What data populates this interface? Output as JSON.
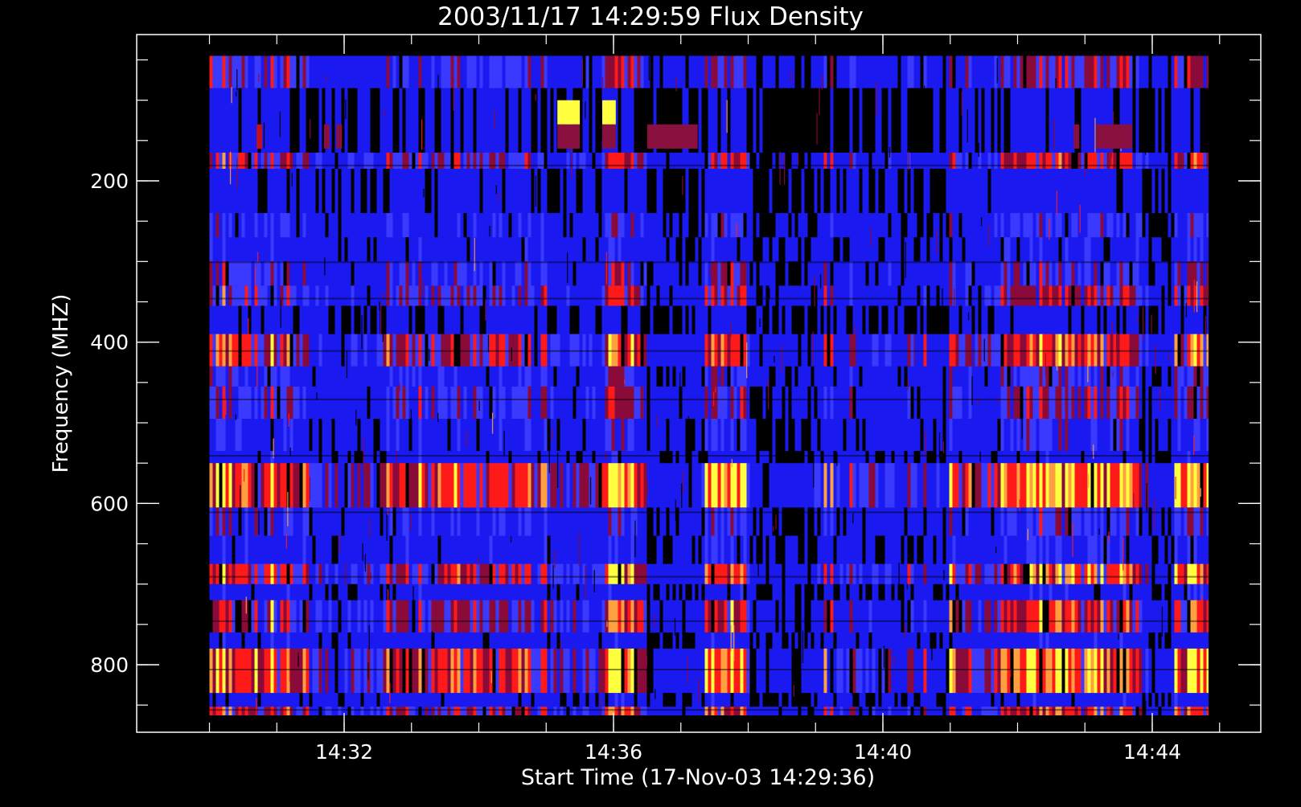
{
  "chart_data": {
    "type": "heatmap",
    "title": "2003/11/17 14:29:59 Flux Density",
    "xlabel": "Start Time (17-Nov-03 14:29:36)",
    "ylabel": "Frequency (MHZ)",
    "x_unit": "time (HH:MM)",
    "xlim": [
      "14:29:36",
      "14:45:00"
    ],
    "ylim": [
      850,
      45
    ],
    "y_inverted": true,
    "x_ticks": [
      {
        "value": "14:32",
        "label": "14:32"
      },
      {
        "value": "14:36",
        "label": "14:36"
      },
      {
        "value": "14:40",
        "label": "14:40"
      },
      {
        "value": "14:44",
        "label": "14:44"
      }
    ],
    "y_ticks": [
      {
        "value": 200,
        "label": "200"
      },
      {
        "value": 400,
        "label": "400"
      },
      {
        "value": 600,
        "label": "600"
      },
      {
        "value": 800,
        "label": "800"
      }
    ],
    "x_minor_ticks_minutes": [
      "14:30",
      "14:31",
      "14:32",
      "14:33",
      "14:34",
      "14:35",
      "14:36",
      "14:37",
      "14:38",
      "14:39",
      "14:40",
      "14:41",
      "14:42",
      "14:43",
      "14:44",
      "14:45"
    ],
    "y_minor_ticks": [
      50,
      100,
      150,
      200,
      250,
      300,
      350,
      400,
      450,
      500,
      550,
      600,
      650,
      700,
      750,
      800,
      850
    ],
    "data_extent": {
      "time_start": "14:30:00",
      "time_end": "14:45:00",
      "freq_top": 45,
      "freq_bottom": 867
    },
    "colormap": [
      "#000000",
      "#1010ff",
      "#3a3aff",
      "#8a0a3a",
      "#ff1a1a",
      "#ffa040",
      "#ffff40"
    ],
    "background_color": "#1a1af0",
    "frequency_bands": [
      {
        "f1": 45,
        "f2": 85,
        "intensity": 0.55
      },
      {
        "f1": 85,
        "f2": 165,
        "intensity": 0.15
      },
      {
        "f1": 165,
        "f2": 185,
        "intensity": 0.65
      },
      {
        "f1": 185,
        "f2": 240,
        "intensity": 0.25
      },
      {
        "f1": 240,
        "f2": 270,
        "intensity": 0.45
      },
      {
        "f1": 270,
        "f2": 300,
        "intensity": 0.35
      },
      {
        "f1": 300,
        "f2": 330,
        "intensity": 0.5
      },
      {
        "f1": 330,
        "f2": 355,
        "intensity": 0.6
      },
      {
        "f1": 355,
        "f2": 390,
        "intensity": 0.2
      },
      {
        "f1": 390,
        "f2": 430,
        "intensity": 0.75
      },
      {
        "f1": 430,
        "f2": 455,
        "intensity": 0.45
      },
      {
        "f1": 455,
        "f2": 495,
        "intensity": 0.55
      },
      {
        "f1": 495,
        "f2": 535,
        "intensity": 0.4
      },
      {
        "f1": 535,
        "f2": 550,
        "intensity": 0.3
      },
      {
        "f1": 550,
        "f2": 605,
        "intensity": 0.9
      },
      {
        "f1": 605,
        "f2": 640,
        "intensity": 0.45
      },
      {
        "f1": 640,
        "f2": 675,
        "intensity": 0.35
      },
      {
        "f1": 675,
        "f2": 700,
        "intensity": 0.8
      },
      {
        "f1": 700,
        "f2": 720,
        "intensity": 0.3
      },
      {
        "f1": 720,
        "f2": 760,
        "intensity": 0.7
      },
      {
        "f1": 760,
        "f2": 780,
        "intensity": 0.3
      },
      {
        "f1": 780,
        "f2": 835,
        "intensity": 0.85
      },
      {
        "f1": 835,
        "f2": 852,
        "intensity": 0.3
      },
      {
        "f1": 852,
        "f2": 867,
        "intensity": 0.7
      }
    ],
    "burst_periods": [
      {
        "t1": "14:30:00",
        "t2": "14:31:30",
        "intensity": 0.8
      },
      {
        "t1": "14:31:30",
        "t2": "14:32:30",
        "intensity": 0.5
      },
      {
        "t1": "14:32:30",
        "t2": "14:33:30",
        "intensity": 0.65
      },
      {
        "t1": "14:33:30",
        "t2": "14:35:00",
        "intensity": 0.75
      },
      {
        "t1": "14:35:00",
        "t2": "14:35:50",
        "intensity": 0.55
      },
      {
        "t1": "14:35:50",
        "t2": "14:36:30",
        "intensity": 0.95
      },
      {
        "t1": "14:36:30",
        "t2": "14:37:20",
        "intensity": 0.3
      },
      {
        "t1": "14:37:20",
        "t2": "14:38:00",
        "intensity": 0.95
      },
      {
        "t1": "14:38:00",
        "t2": "14:39:00",
        "intensity": 0.2
      },
      {
        "t1": "14:39:00",
        "t2": "14:40:10",
        "intensity": 0.5
      },
      {
        "t1": "14:40:10",
        "t2": "14:41:00",
        "intensity": 0.35
      },
      {
        "t1": "14:41:00",
        "t2": "14:41:40",
        "intensity": 0.7
      },
      {
        "t1": "14:41:40",
        "t2": "14:43:50",
        "intensity": 0.9
      },
      {
        "t1": "14:43:50",
        "t2": "14:44:20",
        "intensity": 0.25
      },
      {
        "t1": "14:44:20",
        "t2": "14:45:00",
        "intensity": 0.95
      }
    ],
    "highlight_patches": [
      {
        "t1": "14:35:10",
        "t2": "14:35:30",
        "f1": 100,
        "f2": 130,
        "color": "#ffff40"
      },
      {
        "t1": "14:35:50",
        "t2": "14:36:02",
        "f1": 100,
        "f2": 130,
        "color": "#ffff40"
      },
      {
        "t1": "14:35:10",
        "t2": "14:35:30",
        "f1": 130,
        "f2": 160,
        "color": "#8a1040"
      },
      {
        "t1": "14:35:50",
        "t2": "14:36:02",
        "f1": 130,
        "f2": 160,
        "color": "#8a1040"
      },
      {
        "t1": "14:36:30",
        "t2": "14:37:15",
        "f1": 130,
        "f2": 160,
        "color": "#8a1040"
      },
      {
        "t1": "14:43:10",
        "t2": "14:43:42",
        "f1": 130,
        "f2": 160,
        "color": "#8a1040"
      },
      {
        "t1": "14:30:42",
        "t2": "14:30:47",
        "f1": 130,
        "f2": 160,
        "color": "#c01020"
      },
      {
        "t1": "14:31:42",
        "t2": "14:31:47",
        "f1": 130,
        "f2": 160,
        "color": "#8a1040"
      },
      {
        "t1": "14:31:53",
        "t2": "14:31:58",
        "f1": 130,
        "f2": 160,
        "color": "#8a1040"
      },
      {
        "t1": "14:42:50",
        "t2": "14:42:55",
        "f1": 130,
        "f2": 160,
        "color": "#8a1040"
      }
    ],
    "grid": false,
    "legend": "none"
  }
}
